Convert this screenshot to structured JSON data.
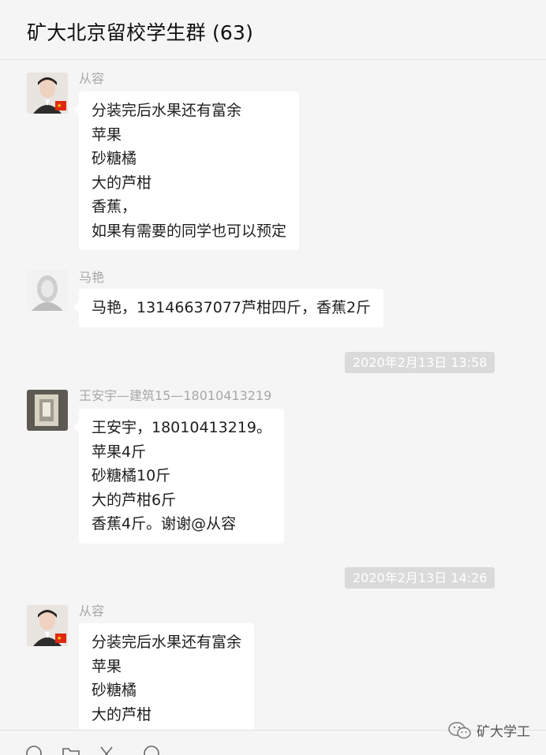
{
  "window": {
    "title": "矿大北京留校学生群 (63)"
  },
  "messages": [
    {
      "sender": "从容",
      "lines": [
        "分装完后水果还有富余",
        "苹果",
        "砂糖橘",
        "大的芦柑",
        "香蕉，",
        "如果有需要的同学也可以预定"
      ]
    },
    {
      "sender": "马艳",
      "lines": [
        "马艳，13146637077芦柑四斤，香蕉2斤"
      ]
    },
    {
      "sender": "王安宇—建筑15—18010413219",
      "lines": [
        "王安宇，18010413219。",
        "苹果4斤",
        "砂糖橘10斤",
        "大的芦柑6斤",
        "香蕉4斤。谢谢@从容"
      ]
    },
    {
      "sender": "从容",
      "lines": [
        "分装完后水果还有富余",
        "苹果",
        "砂糖橘",
        "大的芦柑"
      ]
    }
  ],
  "timestamps": [
    "2020年2月13日 13:58",
    "2020年2月13日 14:26"
  ],
  "toolbar": {
    "icons": [
      "emoji-icon",
      "folder-icon",
      "scissors-icon",
      "chat-history-icon"
    ]
  },
  "watermark": {
    "text": "矿大学工",
    "icon": "wechat-icon"
  },
  "colors": {
    "accent_flag": "#de2910",
    "bubble": "#ffffff",
    "background": "#f5f5f5",
    "time_badge": "#dadada"
  }
}
